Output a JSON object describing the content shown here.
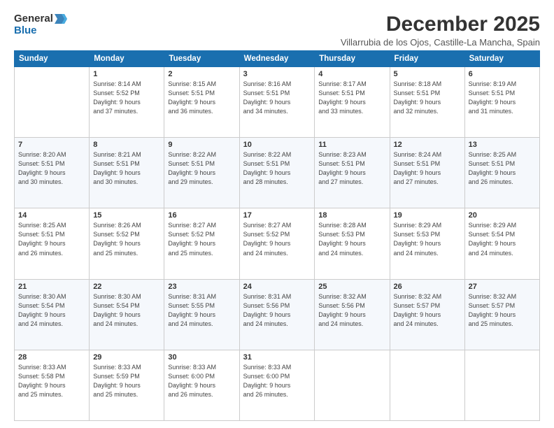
{
  "header": {
    "logo_line1": "General",
    "logo_line2": "Blue",
    "month_title": "December 2025",
    "location": "Villarrubia de los Ojos, Castille-La Mancha, Spain"
  },
  "weekdays": [
    "Sunday",
    "Monday",
    "Tuesday",
    "Wednesday",
    "Thursday",
    "Friday",
    "Saturday"
  ],
  "weeks": [
    [
      {
        "day": "",
        "info": ""
      },
      {
        "day": "1",
        "info": "Sunrise: 8:14 AM\nSunset: 5:52 PM\nDaylight: 9 hours\nand 37 minutes."
      },
      {
        "day": "2",
        "info": "Sunrise: 8:15 AM\nSunset: 5:51 PM\nDaylight: 9 hours\nand 36 minutes."
      },
      {
        "day": "3",
        "info": "Sunrise: 8:16 AM\nSunset: 5:51 PM\nDaylight: 9 hours\nand 34 minutes."
      },
      {
        "day": "4",
        "info": "Sunrise: 8:17 AM\nSunset: 5:51 PM\nDaylight: 9 hours\nand 33 minutes."
      },
      {
        "day": "5",
        "info": "Sunrise: 8:18 AM\nSunset: 5:51 PM\nDaylight: 9 hours\nand 32 minutes."
      },
      {
        "day": "6",
        "info": "Sunrise: 8:19 AM\nSunset: 5:51 PM\nDaylight: 9 hours\nand 31 minutes."
      }
    ],
    [
      {
        "day": "7",
        "info": "Sunrise: 8:20 AM\nSunset: 5:51 PM\nDaylight: 9 hours\nand 30 minutes."
      },
      {
        "day": "8",
        "info": "Sunrise: 8:21 AM\nSunset: 5:51 PM\nDaylight: 9 hours\nand 30 minutes."
      },
      {
        "day": "9",
        "info": "Sunrise: 8:22 AM\nSunset: 5:51 PM\nDaylight: 9 hours\nand 29 minutes."
      },
      {
        "day": "10",
        "info": "Sunrise: 8:22 AM\nSunset: 5:51 PM\nDaylight: 9 hours\nand 28 minutes."
      },
      {
        "day": "11",
        "info": "Sunrise: 8:23 AM\nSunset: 5:51 PM\nDaylight: 9 hours\nand 27 minutes."
      },
      {
        "day": "12",
        "info": "Sunrise: 8:24 AM\nSunset: 5:51 PM\nDaylight: 9 hours\nand 27 minutes."
      },
      {
        "day": "13",
        "info": "Sunrise: 8:25 AM\nSunset: 5:51 PM\nDaylight: 9 hours\nand 26 minutes."
      }
    ],
    [
      {
        "day": "14",
        "info": "Sunrise: 8:25 AM\nSunset: 5:51 PM\nDaylight: 9 hours\nand 26 minutes."
      },
      {
        "day": "15",
        "info": "Sunrise: 8:26 AM\nSunset: 5:52 PM\nDaylight: 9 hours\nand 25 minutes."
      },
      {
        "day": "16",
        "info": "Sunrise: 8:27 AM\nSunset: 5:52 PM\nDaylight: 9 hours\nand 25 minutes."
      },
      {
        "day": "17",
        "info": "Sunrise: 8:27 AM\nSunset: 5:52 PM\nDaylight: 9 hours\nand 24 minutes."
      },
      {
        "day": "18",
        "info": "Sunrise: 8:28 AM\nSunset: 5:53 PM\nDaylight: 9 hours\nand 24 minutes."
      },
      {
        "day": "19",
        "info": "Sunrise: 8:29 AM\nSunset: 5:53 PM\nDaylight: 9 hours\nand 24 minutes."
      },
      {
        "day": "20",
        "info": "Sunrise: 8:29 AM\nSunset: 5:54 PM\nDaylight: 9 hours\nand 24 minutes."
      }
    ],
    [
      {
        "day": "21",
        "info": "Sunrise: 8:30 AM\nSunset: 5:54 PM\nDaylight: 9 hours\nand 24 minutes."
      },
      {
        "day": "22",
        "info": "Sunrise: 8:30 AM\nSunset: 5:54 PM\nDaylight: 9 hours\nand 24 minutes."
      },
      {
        "day": "23",
        "info": "Sunrise: 8:31 AM\nSunset: 5:55 PM\nDaylight: 9 hours\nand 24 minutes."
      },
      {
        "day": "24",
        "info": "Sunrise: 8:31 AM\nSunset: 5:56 PM\nDaylight: 9 hours\nand 24 minutes."
      },
      {
        "day": "25",
        "info": "Sunrise: 8:32 AM\nSunset: 5:56 PM\nDaylight: 9 hours\nand 24 minutes."
      },
      {
        "day": "26",
        "info": "Sunrise: 8:32 AM\nSunset: 5:57 PM\nDaylight: 9 hours\nand 24 minutes."
      },
      {
        "day": "27",
        "info": "Sunrise: 8:32 AM\nSunset: 5:57 PM\nDaylight: 9 hours\nand 25 minutes."
      }
    ],
    [
      {
        "day": "28",
        "info": "Sunrise: 8:33 AM\nSunset: 5:58 PM\nDaylight: 9 hours\nand 25 minutes."
      },
      {
        "day": "29",
        "info": "Sunrise: 8:33 AM\nSunset: 5:59 PM\nDaylight: 9 hours\nand 25 minutes."
      },
      {
        "day": "30",
        "info": "Sunrise: 8:33 AM\nSunset: 6:00 PM\nDaylight: 9 hours\nand 26 minutes."
      },
      {
        "day": "31",
        "info": "Sunrise: 8:33 AM\nSunset: 6:00 PM\nDaylight: 9 hours\nand 26 minutes."
      },
      {
        "day": "",
        "info": ""
      },
      {
        "day": "",
        "info": ""
      },
      {
        "day": "",
        "info": ""
      }
    ]
  ]
}
